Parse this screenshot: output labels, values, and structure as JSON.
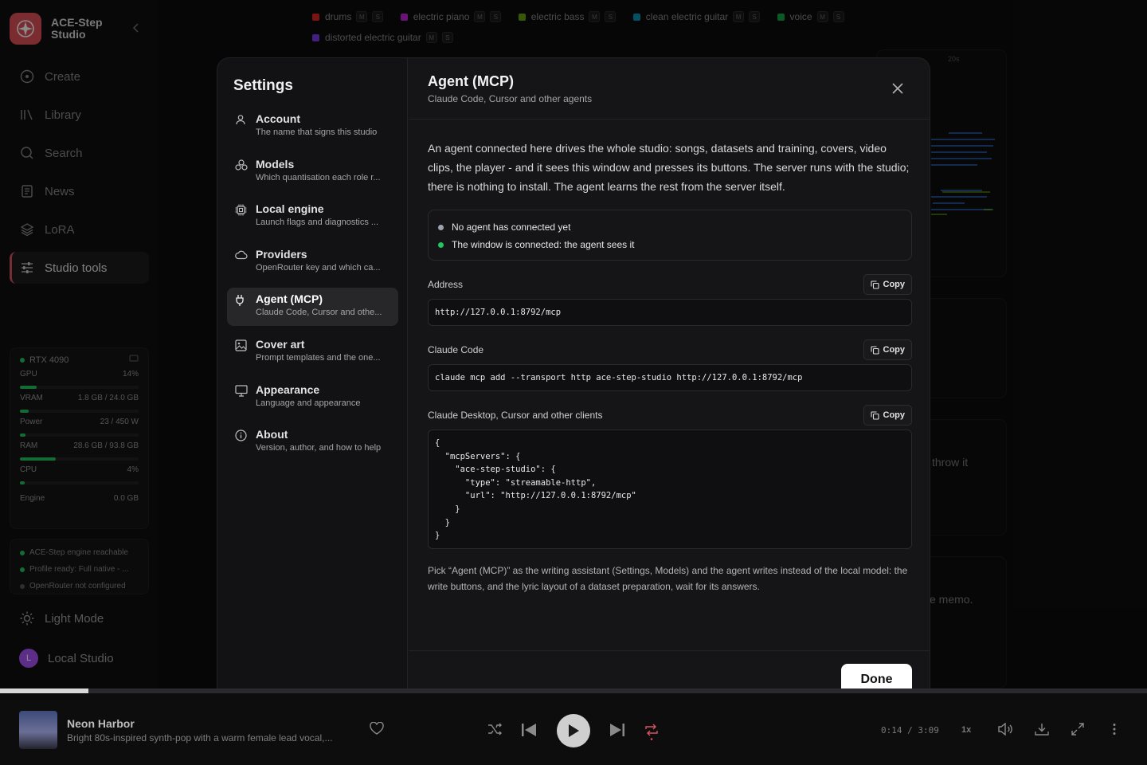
{
  "app": {
    "brand_name": "ACE-Step Studio",
    "nav": [
      {
        "label": "Create",
        "icon": "create-icon"
      },
      {
        "label": "Library",
        "icon": "library-icon"
      },
      {
        "label": "Search",
        "icon": "search-icon"
      },
      {
        "label": "News",
        "icon": "news-icon"
      },
      {
        "label": "LoRA",
        "icon": "layers-icon"
      },
      {
        "label": "Studio tools",
        "icon": "sliders-icon",
        "active": true
      }
    ],
    "hardware": {
      "gpu_name": "RTX 4090",
      "metrics": [
        {
          "label": "GPU",
          "value": "14%",
          "fraction": 0.14
        },
        {
          "label": "VRAM",
          "value": "1.8 GB / 24.0 GB",
          "fraction": 0.075
        },
        {
          "label": "Power",
          "value": "23 / 450 W",
          "fraction": 0.05
        },
        {
          "label": "RAM",
          "value": "28.6 GB / 93.8 GB",
          "fraction": 0.3
        },
        {
          "label": "CPU",
          "value": "4%",
          "fraction": 0.04
        }
      ],
      "engine_label": "Engine",
      "engine_value": "0.0 GB"
    },
    "status": [
      "ACE-Step engine reachable",
      "Profile ready: Full native - ...",
      "OpenRouter not configured"
    ],
    "light_mode_label": "Light Mode",
    "profile_initial": "L",
    "profile_label": "Local Studio"
  },
  "background": {
    "tracks": [
      {
        "name": "drums",
        "color": "#dc2626"
      },
      {
        "name": "electric piano",
        "color": "#c026d3"
      },
      {
        "name": "electric bass",
        "color": "#65a30d"
      },
      {
        "name": "clean electric guitar",
        "color": "#0891b2"
      },
      {
        "name": "voice",
        "color": "#16a34a"
      },
      {
        "name": "distorted electric guitar",
        "color": "#7c3aed"
      }
    ],
    "mute_label": "M",
    "solo_label": "S",
    "timeline_mark": "20s",
    "fragment_1": "throw it",
    "fragment_2": "e memo."
  },
  "settings": {
    "title": "Settings",
    "items": [
      {
        "title": "Account",
        "desc": "The name that signs this studio",
        "icon": "user-icon"
      },
      {
        "title": "Models",
        "desc": "Which quantisation each role r...",
        "icon": "models-icon"
      },
      {
        "title": "Local engine",
        "desc": "Launch flags and diagnostics ...",
        "icon": "chip-icon"
      },
      {
        "title": "Providers",
        "desc": "OpenRouter key and which ca...",
        "icon": "cloud-icon"
      },
      {
        "title": "Agent (MCP)",
        "desc": "Claude Code, Cursor and othe...",
        "icon": "plug-icon",
        "active": true
      },
      {
        "title": "Cover art",
        "desc": "Prompt templates and the one...",
        "icon": "image-icon"
      },
      {
        "title": "Appearance",
        "desc": "Language and appearance",
        "icon": "monitor-icon"
      },
      {
        "title": "About",
        "desc": "Version, author, and how to help",
        "icon": "info-icon"
      }
    ]
  },
  "panel": {
    "title": "Agent (MCP)",
    "subtitle": "Claude Code, Cursor and other agents",
    "intro": "An agent connected here drives the whole studio: songs, datasets and training, covers, video clips, the player - and it sees this window and presses its buttons. The server runs with the studio; there is nothing to install. The agent learns the rest from the server itself.",
    "status_agent": "No agent has connected yet",
    "status_window": "The window is connected: the agent sees it",
    "status_agent_color": "#9ca3af",
    "status_window_color": "#22c55e",
    "copy_label": "Copy",
    "address_label": "Address",
    "address_value": "http://127.0.0.1:8792/mcp",
    "claude_code_label": "Claude Code",
    "claude_code_value": "claude mcp add --transport http ace-step-studio http://127.0.0.1:8792/mcp",
    "clients_label": "Claude Desktop, Cursor and other clients",
    "clients_value": "{\n  \"mcpServers\": {\n    \"ace-step-studio\": {\n      \"type\": \"streamable-http\",\n      \"url\": \"http://127.0.0.1:8792/mcp\"\n    }\n  }\n}",
    "note": "Pick “Agent (MCP)” as the writing assistant (Settings, Models) and the agent writes instead of the local model: the write buttons, and the lyric layout of a dataset preparation, wait for its answers.",
    "done_label": "Done"
  },
  "player": {
    "title": "Neon Harbor",
    "description": "Bright 80s-inspired synth-pop with a warm female lead vocal,...",
    "time": "0:14 / 3:09",
    "speed": "1x",
    "progress_fraction": 0.077
  },
  "colors": {
    "accent": "#d85560",
    "ok": "#22c55e"
  }
}
